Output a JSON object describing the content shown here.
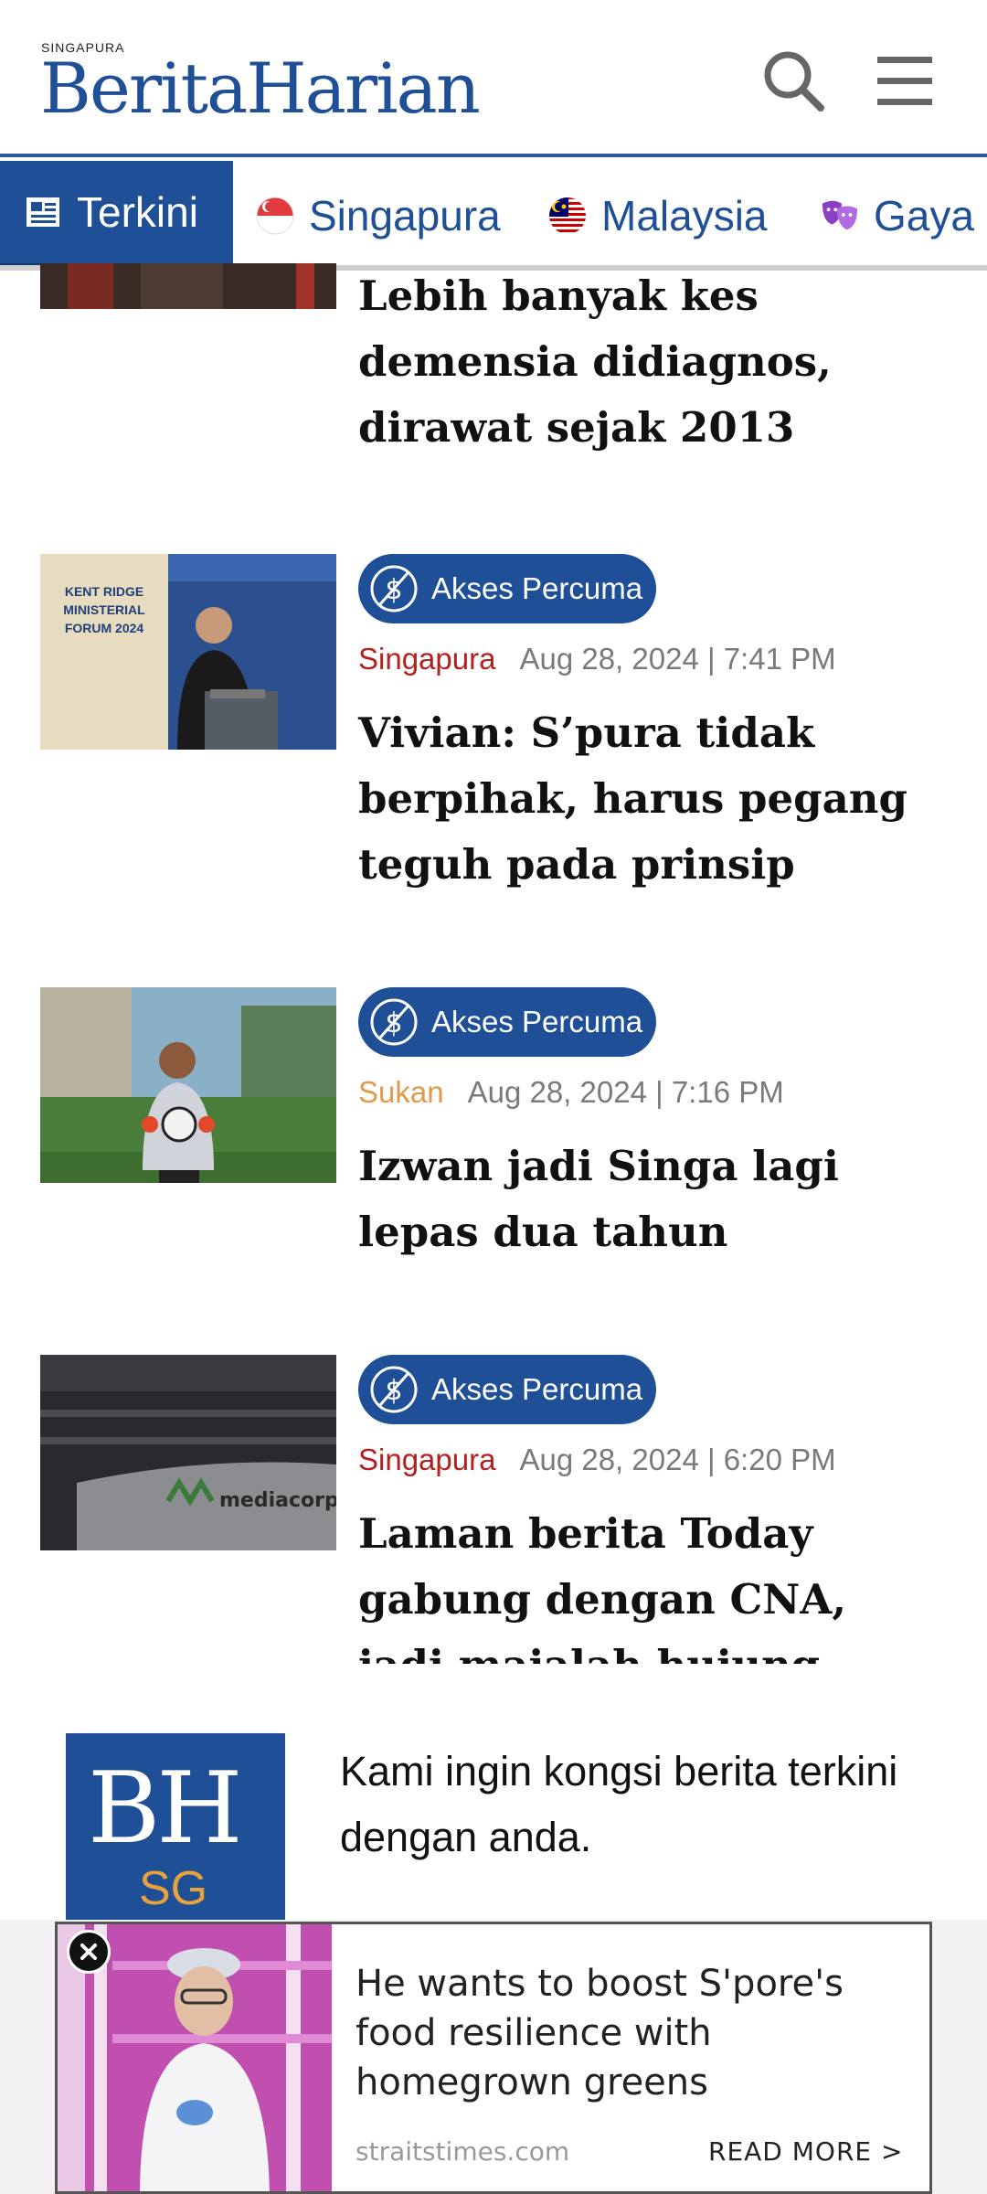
{
  "header": {
    "logo_small": "SINGAPURA",
    "logo_main": "BeritaHarian"
  },
  "nav": {
    "tabs": [
      {
        "label": "Terkini",
        "icon": "newspaper-icon",
        "active": true
      },
      {
        "label": "Singapura",
        "icon": "singapore-flag-icon"
      },
      {
        "label": "Malaysia",
        "icon": "malaysia-flag-icon"
      },
      {
        "label": "Gaya",
        "icon": "theatre-masks-icon"
      }
    ]
  },
  "articles": [
    {
      "headline": "Lebih banyak kes demensia didiagnos, dirawat sejak 2013"
    },
    {
      "badge": "Akses Percuma",
      "category": "Singapura",
      "date": "Aug 28, 2024 | 7:41 PM",
      "headline": "Vivian: S’pura tidak berpihak, harus pegang teguh pada prinsip",
      "thumb_text": [
        "KENT RIDGE",
        "MINISTERIAL",
        "FORUM 2024"
      ]
    },
    {
      "badge": "Akses Percuma",
      "category": "Sukan",
      "date": "Aug 28, 2024 | 7:16 PM",
      "headline": "Izwan jadi Singa lagi lepas dua tahun"
    },
    {
      "badge": "Akses Percuma",
      "category": "Singapura",
      "date": "Aug 28, 2024 | 6:20 PM",
      "headline": "Laman berita Today gabung dengan CNA, jadi majalah hujung minggu",
      "thumb_text": "mediacorp"
    }
  ],
  "prompt": {
    "logo_bh": "BH",
    "logo_sg": "SG",
    "text": "Kami ingin kongsi berita terkini dengan anda."
  },
  "ad": {
    "title": "He wants to boost S'pore's food resilience with homegrown greens",
    "source": "straitstimes.com",
    "cta": "READ MORE >"
  },
  "colors": {
    "brand_blue": "#1f4f96",
    "category_red": "#b3201e",
    "category_orange": "#e09a4a",
    "meta_grey": "#7a7a7a"
  }
}
